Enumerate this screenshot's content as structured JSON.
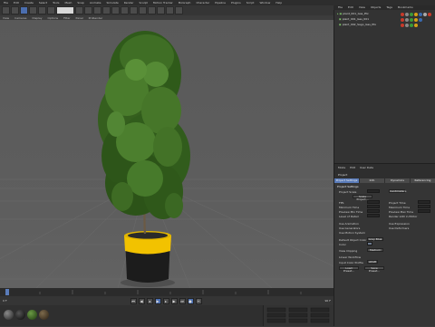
{
  "menubar": {
    "items": [
      "File",
      "Edit",
      "Create",
      "Select",
      "Tools",
      "Mesh",
      "Snap",
      "Animate",
      "Simulate",
      "Render",
      "Sculpt",
      "Motion Tracker",
      "MoGraph",
      "Character",
      "Pipeline",
      "Plugins",
      "Script",
      "Window",
      "Help"
    ]
  },
  "viewport_menu": {
    "items": [
      "View",
      "Cameras",
      "Display",
      "Options",
      "Filter",
      "Panel",
      "ProRender"
    ]
  },
  "object_manager": {
    "tabs": [
      "File",
      "Edit",
      "View",
      "Objects",
      "Tags",
      "Bookmarks"
    ],
    "objects": [
      "plant_001_Gas_Ptx",
      "plant_001_Gas_001",
      "plant_002_Sago_Gas_Ptx"
    ]
  },
  "attribute_manager": {
    "menu": [
      "Mode",
      "Edit",
      "User Data"
    ],
    "object_label": "Project",
    "tabs": [
      "Project Settings",
      "Info",
      "Dynamics",
      "Referencing"
    ],
    "section": "Project Settings",
    "fields": [
      {
        "label": "Project Scale",
        "value": "1"
      },
      {
        "label": "Scale Project...",
        "value": ""
      },
      {
        "label": "FPS",
        "value": "30"
      },
      {
        "label": "Minimum Time",
        "value": "0 F"
      },
      {
        "label": "Preview Min Time",
        "value": "0 F"
      },
      {
        "label": "Level of Detail",
        "value": "100 %"
      },
      {
        "label": "Use Animation",
        "value": ""
      },
      {
        "label": "Use Generators",
        "value": ""
      },
      {
        "label": "Use Motion System",
        "value": ""
      },
      {
        "label": "Default Object Color",
        "value": "Gray Blue"
      },
      {
        "label": "Color",
        "value": ""
      },
      {
        "label": "View Clipping",
        "value": "Medium"
      },
      {
        "label": "Linear Workflow",
        "value": ""
      },
      {
        "label": "Input Color Profile",
        "value": "sRGB"
      }
    ],
    "right_fields": [
      {
        "label": "Project Time",
        "value": "0 F"
      },
      {
        "label": "Maximum Time",
        "value": "90 F"
      },
      {
        "label": "Preview Max Time",
        "value": "90 F"
      },
      {
        "label": "Render LOD in Editor",
        "value": ""
      },
      {
        "label": "Use Expression",
        "value": ""
      },
      {
        "label": "Use Deformers",
        "value": ""
      }
    ],
    "buttons": [
      "Load Preset...",
      "Save Preset..."
    ],
    "units": "Centimeters"
  },
  "timeline": {
    "frame": "0 F",
    "end": "90 F"
  },
  "colors": {
    "accent": "#4b6eaf",
    "pot_band": "#f2c200",
    "pot_body": "#1c1c1c",
    "foliage": "#3f6e25"
  }
}
